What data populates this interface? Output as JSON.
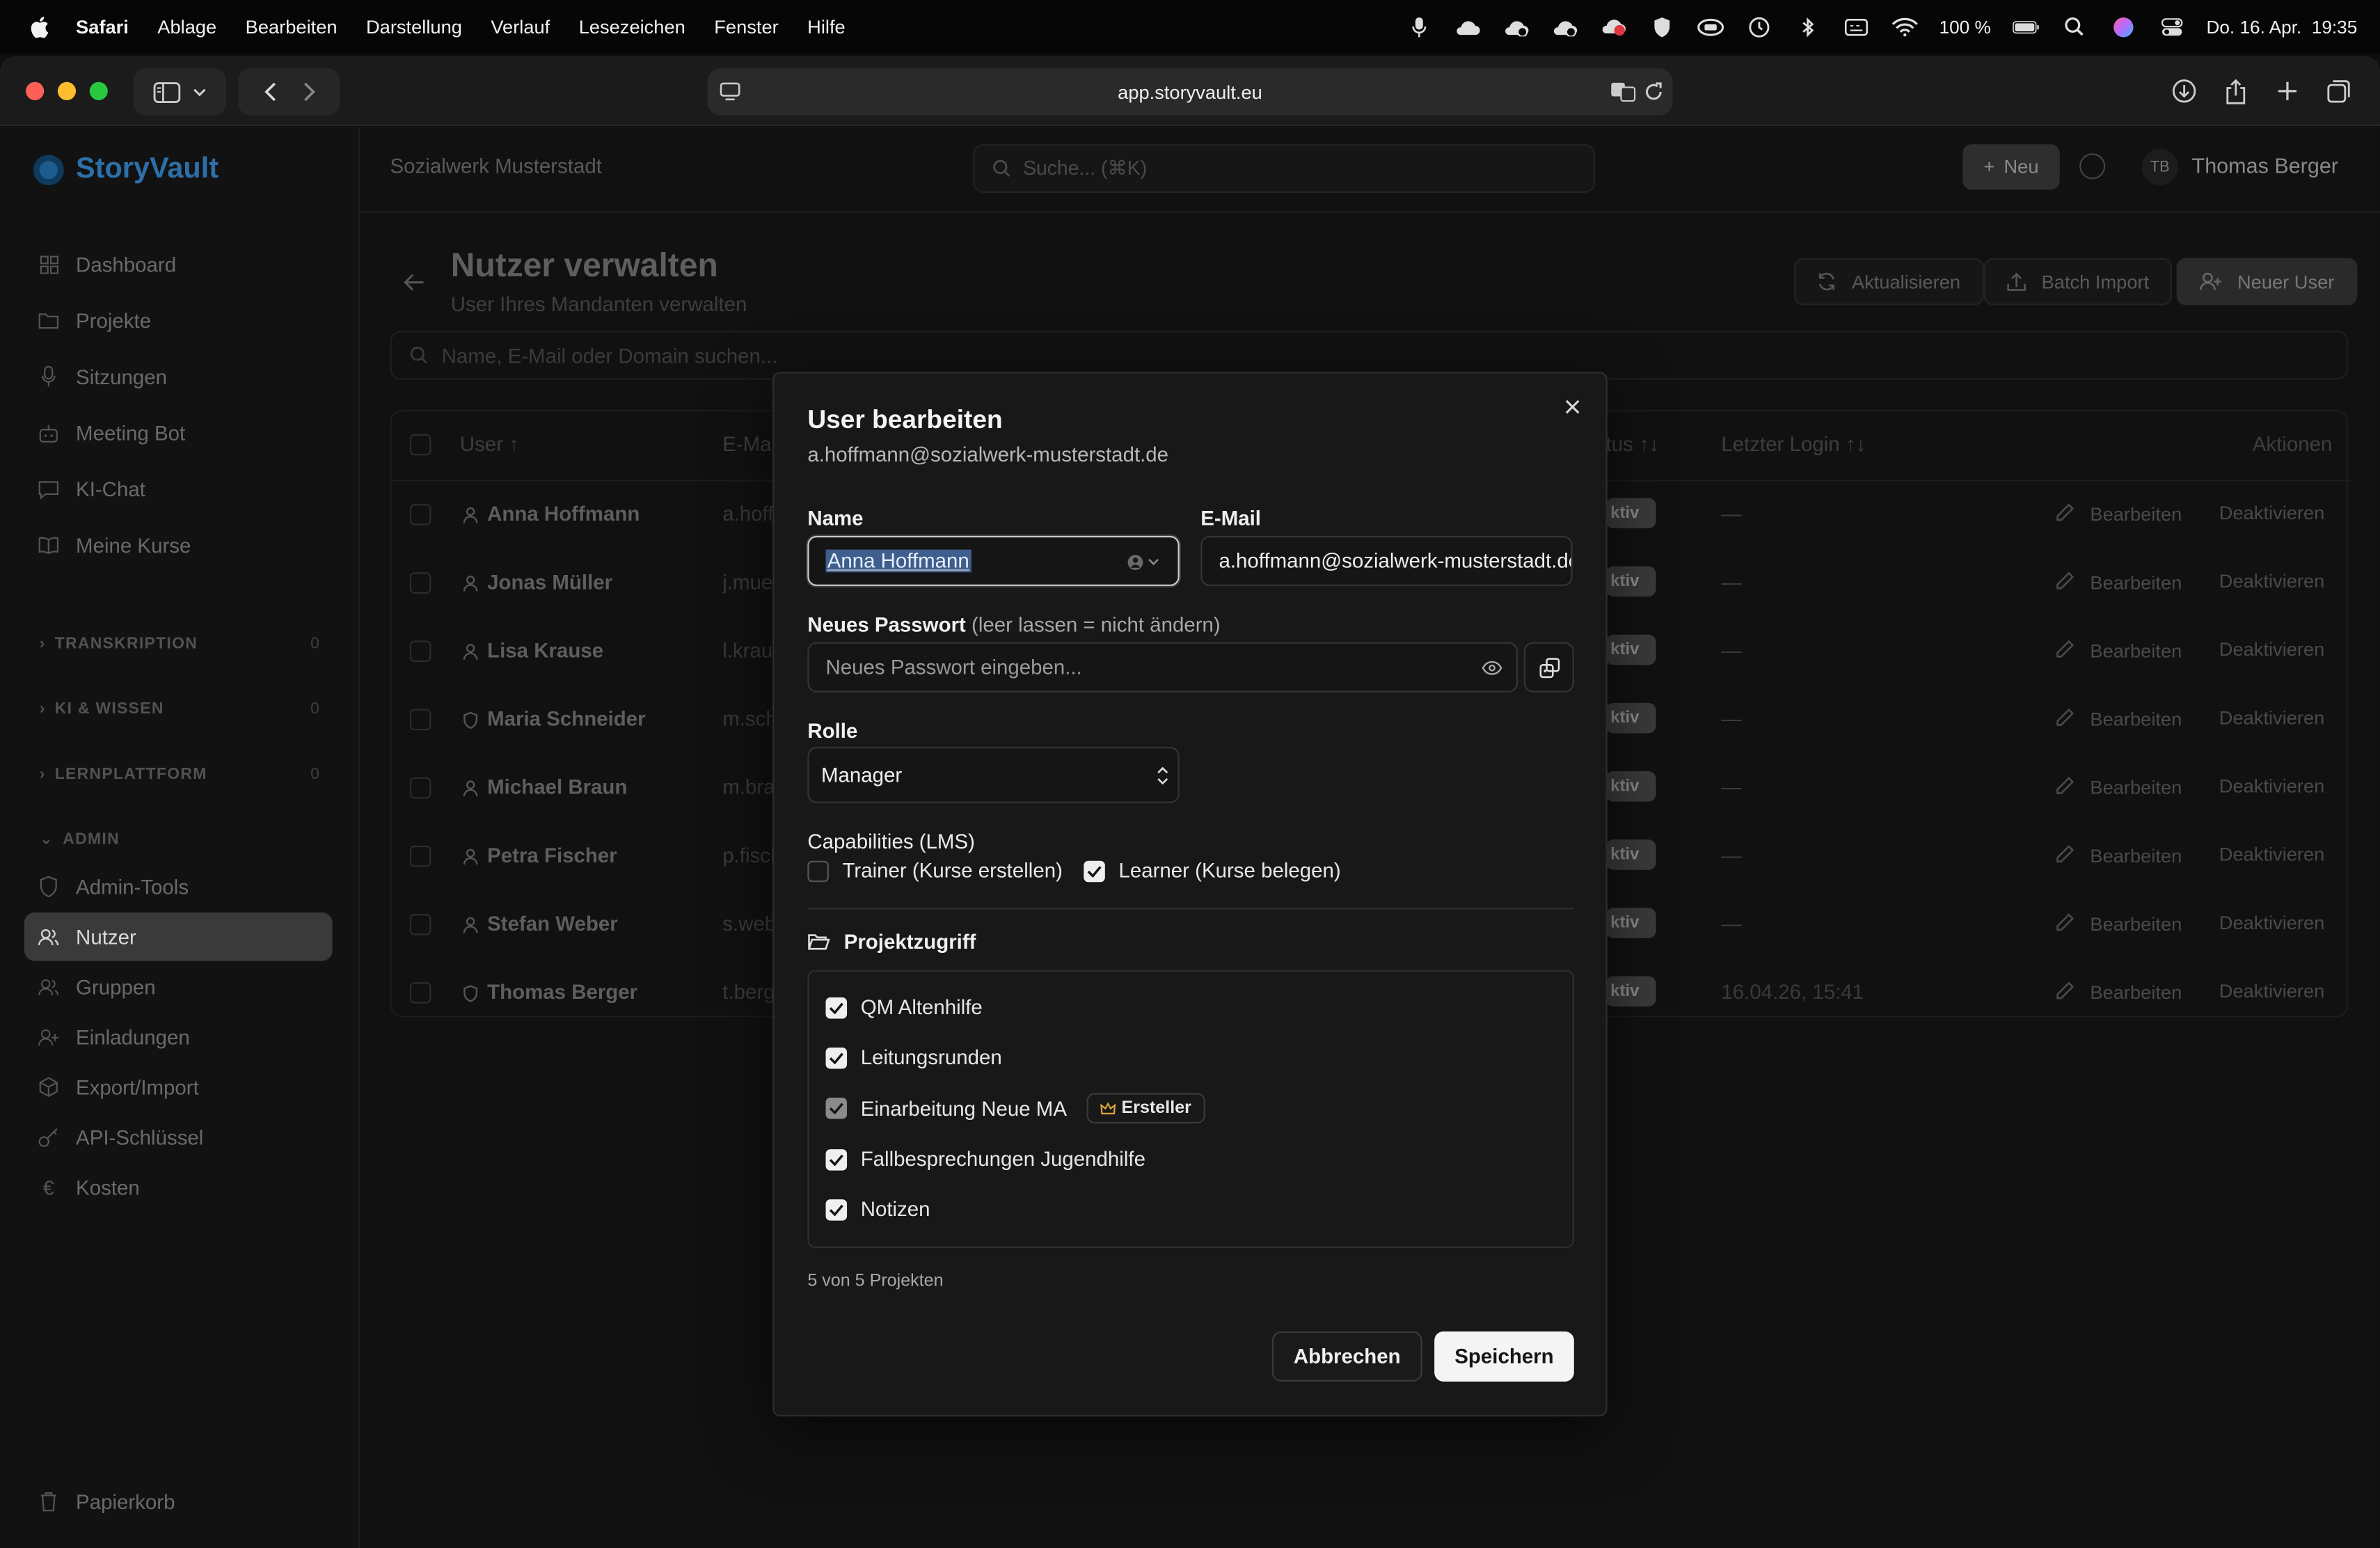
{
  "menubar": {
    "app": "Safari",
    "items": [
      "Ablage",
      "Bearbeiten",
      "Darstellung",
      "Verlauf",
      "Lesezeichen",
      "Fenster",
      "Hilfe"
    ],
    "battery": "100 %",
    "datetime": "Do. 16. Apr.  19:35"
  },
  "browser": {
    "url": "app.storyvault.eu"
  },
  "sidebar": {
    "brand": "StoryVault",
    "items": [
      "Dashboard",
      "Projekte",
      "Sitzungen",
      "Meeting Bot",
      "KI-Chat",
      "Meine Kurse"
    ],
    "sections": [
      {
        "label": "TRANSKRIPTION",
        "count": "0"
      },
      {
        "label": "KI & WISSEN",
        "count": "0"
      },
      {
        "label": "LERNPLATTFORM",
        "count": "0"
      },
      {
        "label": "ADMIN"
      }
    ],
    "admin_items": [
      "Admin-Tools",
      "Nutzer",
      "Gruppen",
      "Einladungen",
      "Export/Import",
      "API-Schlüssel",
      "Kosten"
    ],
    "trash": "Papierkorb"
  },
  "topbar": {
    "org": "Sozialwerk Musterstadt",
    "search_placeholder": "Suche... (⌘K)",
    "new_button": "Neu",
    "user_initials": "TB",
    "user_name": "Thomas Berger"
  },
  "page": {
    "title": "Nutzer verwalten",
    "subtitle": "User Ihres Mandanten verwalten",
    "refresh": "Aktualisieren",
    "batch_import": "Batch Import",
    "new_user": "Neuer User",
    "filter_placeholder": "Name, E-Mail oder Domain suchen..."
  },
  "table": {
    "headers": {
      "user": "User ↑",
      "email": "E-Mail",
      "status": "tus ↑↓",
      "last_login": "Letzter Login ↑↓",
      "actions": "Aktionen"
    },
    "rows": [
      {
        "name": "Anna Hoffmann",
        "email": "a.hoffmann",
        "status": "ktiv",
        "last_login": "—",
        "edit": "Bearbeiten",
        "deactivate": "Deaktivieren"
      },
      {
        "name": "Jonas Müller",
        "email": "j.mueller",
        "status": "ktiv",
        "last_login": "—",
        "edit": "Bearbeiten",
        "deactivate": "Deaktivieren"
      },
      {
        "name": "Lisa Krause",
        "email": "l.krause",
        "status": "ktiv",
        "last_login": "—",
        "edit": "Bearbeiten",
        "deactivate": "Deaktivieren"
      },
      {
        "name": "Maria Schneider",
        "email": "m.schneider",
        "status": "ktiv",
        "last_login": "—",
        "edit": "Bearbeiten",
        "deactivate": "Deaktivieren"
      },
      {
        "name": "Michael Braun",
        "email": "m.braun",
        "status": "ktiv",
        "last_login": "—",
        "edit": "Bearbeiten",
        "deactivate": "Deaktivieren"
      },
      {
        "name": "Petra Fischer",
        "email": "p.fischer",
        "status": "ktiv",
        "last_login": "—",
        "edit": "Bearbeiten",
        "deactivate": "Deaktivieren"
      },
      {
        "name": "Stefan Weber",
        "email": "s.weber",
        "status": "ktiv",
        "last_login": "—",
        "edit": "Bearbeiten",
        "deactivate": "Deaktivieren"
      },
      {
        "name": "Thomas Berger",
        "email": "t.berger",
        "status": "ktiv",
        "last_login": "16.04.26, 15:41",
        "edit": "Bearbeiten",
        "deactivate": "Deaktivieren"
      }
    ]
  },
  "modal": {
    "title": "User bearbeiten",
    "subtitle": "a.hoffmann@sozialwerk-musterstadt.de",
    "name_label": "Name",
    "name_value": "Anna Hoffmann",
    "email_label": "E-Mail",
    "email_value": "a.hoffmann@sozialwerk-musterstadt.de",
    "password_label": "Neues Passwort",
    "password_hint": "(leer lassen = nicht ändern)",
    "password_placeholder": "Neues Passwort eingeben...",
    "role_label": "Rolle",
    "role_value": "Manager",
    "capabilities_label": "Capabilities (LMS)",
    "cap_trainer": "Trainer (Kurse erstellen)",
    "cap_learner": "Learner (Kurse belegen)",
    "project_access_label": "Projektzugriff",
    "projects": [
      {
        "name": "QM Altenhilfe"
      },
      {
        "name": "Leitungsrunden"
      },
      {
        "name": "Einarbeitung Neue MA",
        "badge": "Ersteller"
      },
      {
        "name": "Fallbesprechungen Jugendhilfe"
      },
      {
        "name": "Notizen"
      }
    ],
    "project_count": "5 von 5 Projekten",
    "cancel": "Abbrechen",
    "save": "Speichern"
  }
}
